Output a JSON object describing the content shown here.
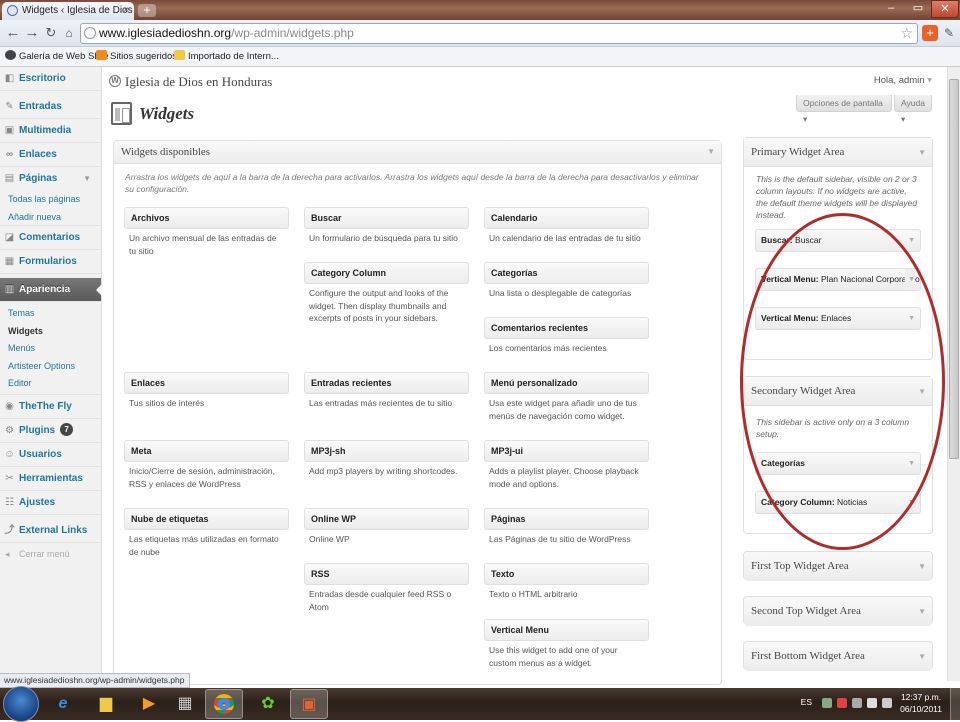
{
  "browser": {
    "tab_title": "Widgets ‹ Iglesia de Dios en",
    "tab_close": "×",
    "new_tab": "+",
    "url_domain": "www.iglesiadedioshn.org",
    "url_path": "/wp-admin/widgets.php",
    "bookmarks": [
      "Galería de Web Slice",
      "Sitios sugeridos",
      "Importado de Intern..."
    ],
    "status_url": "www.iglesiadedioshn.org/wp-admin/widgets.php",
    "window_controls": [
      "–",
      "▭",
      "✕"
    ]
  },
  "admin_menu": {
    "items": [
      {
        "label": "Escritorio",
        "icon": "dashboard-icon"
      },
      {
        "label": "Entradas",
        "icon": "pushpin-icon"
      },
      {
        "label": "Multimedia",
        "icon": "media-icon"
      },
      {
        "label": "Enlaces",
        "icon": "link-icon"
      },
      {
        "label": "Páginas",
        "icon": "pages-icon"
      },
      {
        "label": "Comentarios",
        "icon": "comments-icon"
      },
      {
        "label": "Formularios",
        "icon": "forms-icon"
      },
      {
        "label": "Apariencia",
        "icon": "appearance-icon"
      },
      {
        "label": "TheThe Fly",
        "icon": "thethe-icon"
      },
      {
        "label": "Plugins",
        "icon": "plugin-icon",
        "badge": "7"
      },
      {
        "label": "Usuarios",
        "icon": "users-icon"
      },
      {
        "label": "Herramientas",
        "icon": "tools-icon"
      },
      {
        "label": "Ajustes",
        "icon": "settings-icon"
      },
      {
        "label": "External Links",
        "icon": "external-links-icon"
      }
    ],
    "paginas_sub": [
      "Todas las páginas",
      "Añadir nueva"
    ],
    "apariencia_sub": [
      "Temas",
      "Widgets",
      "Menús",
      "Artisteer Options",
      "Editor"
    ],
    "collapse": "Cerrar menú"
  },
  "header": {
    "site_title": "Iglesia de Dios en Honduras",
    "howdy": "Hola, admin",
    "screen_options": "Opciones de pantalla",
    "help": "Ayuda",
    "page_title": "Widgets"
  },
  "available": {
    "title": "Widgets disponibles",
    "description": "Arrastra los widgets de aquí a la barra de la derecha para activarlos. Arrastra los widgets aquí desde la barra de la derecha para desactivarlos y eliminar su configuración.",
    "widgets": [
      {
        "title": "Archivos",
        "desc": "Un archivo mensual de las entradas de tu sitio"
      },
      {
        "title": "Buscar",
        "desc": "Un formulario de búsqueda para tu sitio"
      },
      {
        "title": "Calendario",
        "desc": "Un calendario de las entradas de tu sitio"
      },
      {
        "title": "Category Column",
        "desc": "Configure the output and looks of the widget. Then display thumbnails and excerpts of posts in your sidebars."
      },
      {
        "title": "Categorías",
        "desc": "Una lista o desplegable de categorías"
      },
      {
        "title": "Comentarios recientes",
        "desc": "Los comentarios más recientes"
      },
      {
        "title": "Enlaces",
        "desc": "Tus sitios de interés"
      },
      {
        "title": "Entradas recientes",
        "desc": "Las entradas más recientes de tu sitio"
      },
      {
        "title": "Menú personalizado",
        "desc": "Usa este widget para añadir uno de tus menús de navegación como widget."
      },
      {
        "title": "Meta",
        "desc": "Inicio/Cierre de sesión, administración, RSS y enlaces de WordPress"
      },
      {
        "title": "MP3j-sh",
        "desc": "Add mp3 players by writing shortcodes."
      },
      {
        "title": "MP3j-ui",
        "desc": "Adds a playlist player. Choose playback mode and options."
      },
      {
        "title": "Nube de etiquetas",
        "desc": "Las etiquetas más utilizadas en formato de nube"
      },
      {
        "title": "Online WP",
        "desc": "Online WP"
      },
      {
        "title": "Páginas",
        "desc": "Las Páginas de tu sitio de WordPress"
      },
      {
        "title": "RSS",
        "desc": "Entradas desde cualquier feed RSS o Atom"
      },
      {
        "title": "Texto",
        "desc": "Texto o HTML arbitrario"
      },
      {
        "title": "Vertical Menu",
        "desc": "Use this widget to add one of your custom menus as a widget."
      }
    ]
  },
  "sidebars": {
    "primary": {
      "title": "Primary Widget Area",
      "desc": "This is the default sidebar, visible on 2 or 3 column layouts. If no widgets are active, the default theme widgets will be displayed instead.",
      "widgets": [
        {
          "name": "Buscar:",
          "title": "Buscar"
        },
        {
          "name": "Vertical Menu:",
          "title": "Plan Nacional Corporativo"
        },
        {
          "name": "Vertical Menu:",
          "title": "Enlaces"
        }
      ]
    },
    "secondary": {
      "title": "Secondary Widget Area",
      "desc": "This sidebar is active only on a 3 column setup.",
      "widgets": [
        {
          "name": "Categorías",
          "title": ""
        },
        {
          "name": "Category Column:",
          "title": "Noticias"
        }
      ]
    },
    "collapsed": [
      "First Top Widget Area",
      "Second Top Widget Area",
      "First Bottom Widget Area"
    ]
  },
  "taskbar": {
    "language": "ES",
    "time": "12:37 p.m.",
    "date": "06/10/2011"
  },
  "colors": {
    "link": "#21759b",
    "highlight_circle": "#b22a2a",
    "current_menu": "#5a5a5a"
  }
}
